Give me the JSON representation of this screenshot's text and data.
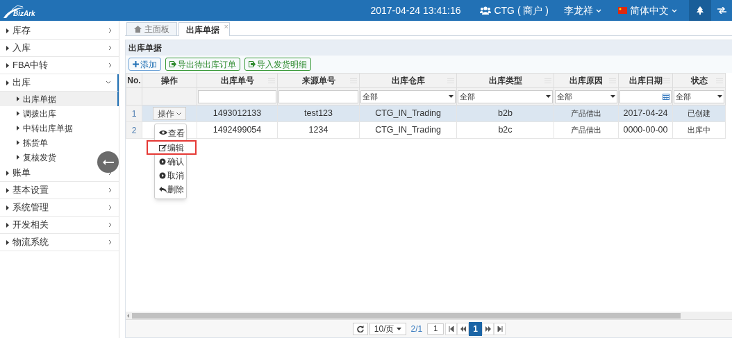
{
  "header": {
    "logo": "BizArk",
    "datetime": "2017-04-24 13:41:16",
    "account": "CTG ( 商户 )",
    "user": "李龙祥",
    "language": "简体中文"
  },
  "sidebar": {
    "items": [
      {
        "label": "库存",
        "expanded": false
      },
      {
        "label": "入库",
        "expanded": false
      },
      {
        "label": "FBA中转",
        "expanded": false
      },
      {
        "label": "出库",
        "expanded": true,
        "children": [
          {
            "label": "出库单据",
            "selected": true
          },
          {
            "label": "调拨出库",
            "selected": false
          },
          {
            "label": "中转出库单据",
            "selected": false
          },
          {
            "label": "拣货单",
            "selected": false
          },
          {
            "label": "复核发货",
            "selected": false
          }
        ]
      },
      {
        "label": "账单",
        "expanded": false
      },
      {
        "label": "基本设置",
        "expanded": false
      },
      {
        "label": "系统管理",
        "expanded": false
      },
      {
        "label": "开发相关",
        "expanded": false
      },
      {
        "label": "物流系统",
        "expanded": false
      }
    ]
  },
  "tabs": [
    {
      "label": "主面板",
      "selected": false,
      "kind": "home"
    },
    {
      "label": "出库单据",
      "selected": true,
      "kind": "closable",
      "close": "×"
    }
  ],
  "panel": {
    "title": "出库单据",
    "toolbar": [
      {
        "label": "添加",
        "kind": "add"
      },
      {
        "label": "导出待出库订单",
        "kind": "export"
      },
      {
        "label": "导入发货明细",
        "kind": "export"
      }
    ],
    "table": {
      "columns": [
        {
          "label": "No.",
          "kind": "none"
        },
        {
          "label": "操作",
          "kind": "none"
        },
        {
          "label": "出库单号",
          "kind": "text"
        },
        {
          "label": "来源单号",
          "kind": "text"
        },
        {
          "label": "出库仓库",
          "kind": "select",
          "value": "全部"
        },
        {
          "label": "出库类型",
          "kind": "select",
          "value": "全部"
        },
        {
          "label": "出库原因",
          "kind": "select",
          "value": "全部"
        },
        {
          "label": "出库日期",
          "kind": "date"
        },
        {
          "label": "状态",
          "kind": "select",
          "value": "全部"
        }
      ],
      "rows": [
        {
          "cells": [
            "1",
            "操作",
            "1493012133",
            "test123",
            "CTG_IN_Trading",
            "b2b",
            "产品借出",
            "2017-04-24",
            "已创建"
          ],
          "selected": true
        },
        {
          "cells": [
            "2",
            "",
            "1492499054",
            "1234",
            "CTG_IN_Trading",
            "b2c",
            "产品借出",
            "0000-00-00",
            "出库中"
          ],
          "selected": false
        }
      ]
    },
    "action_menu": [
      {
        "label": "查看",
        "kind": "eye",
        "highlighted": false
      },
      {
        "label": "编辑",
        "kind": "edit",
        "highlighted": true
      },
      {
        "label": "确认",
        "kind": "play",
        "highlighted": false
      },
      {
        "label": "取消",
        "kind": "play",
        "highlighted": false
      },
      {
        "label": "删除",
        "kind": "reply",
        "highlighted": false
      }
    ],
    "pager": {
      "page_size": "10/页",
      "pages": "2/1",
      "page_input": "1",
      "pages_list": [
        {
          "label": "1",
          "selected": true
        }
      ]
    }
  }
}
